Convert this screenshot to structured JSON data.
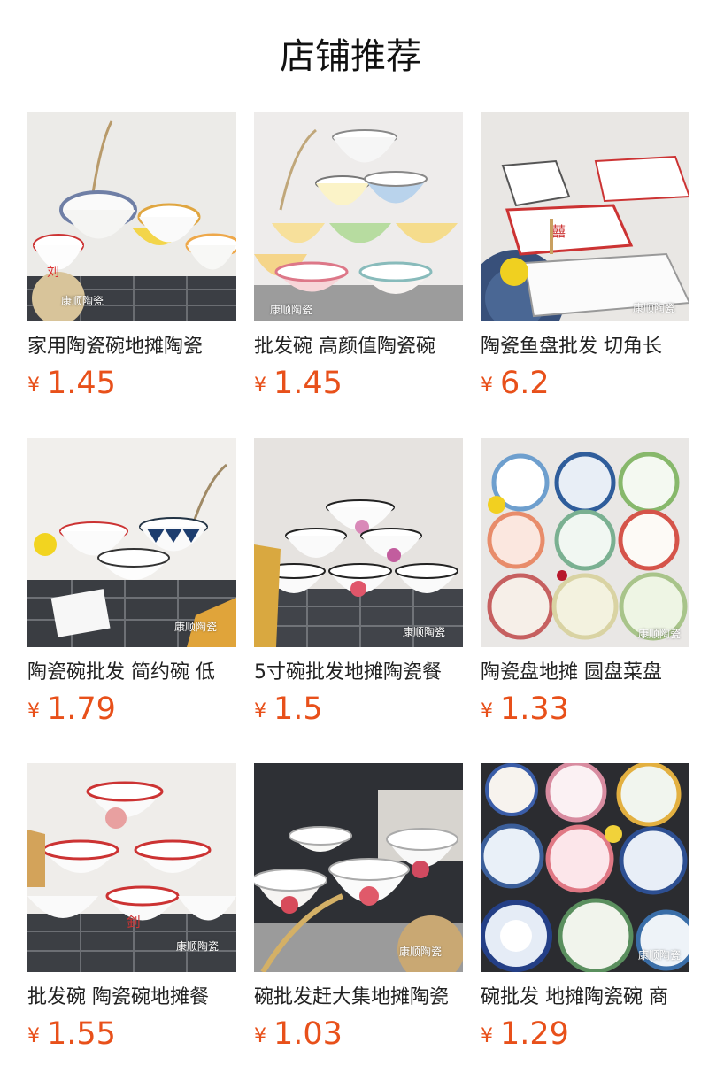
{
  "page_title": "店铺推荐",
  "currency": "¥",
  "accent": "#e8501a",
  "products": [
    {
      "name": "家用陶瓷碗地摊陶瓷",
      "price": "1.45",
      "watermark": "康顺陶瓷"
    },
    {
      "name": "批发碗 高颜值陶瓷碗",
      "price": "1.45",
      "watermark": "康顺陶瓷"
    },
    {
      "name": "陶瓷鱼盘批发 切角长",
      "price": "6.2",
      "watermark": "康顺陶瓷"
    },
    {
      "name": "陶瓷碗批发 简约碗 低",
      "price": "1.79",
      "watermark": "康顺陶瓷"
    },
    {
      "name": "5寸碗批发地摊陶瓷餐",
      "price": "1.5",
      "watermark": "康顺陶瓷"
    },
    {
      "name": "陶瓷盘地摊 圆盘菜盘",
      "price": "1.33",
      "watermark": "康顺陶瓷"
    },
    {
      "name": "批发碗 陶瓷碗地摊餐",
      "price": "1.55",
      "watermark": "康顺陶瓷"
    },
    {
      "name": "碗批发赶大集地摊陶瓷",
      "price": "1.03",
      "watermark": "康顺陶瓷"
    },
    {
      "name": "碗批发 地摊陶瓷碗 商",
      "price": "1.29",
      "watermark": "康顺陶瓷"
    }
  ]
}
